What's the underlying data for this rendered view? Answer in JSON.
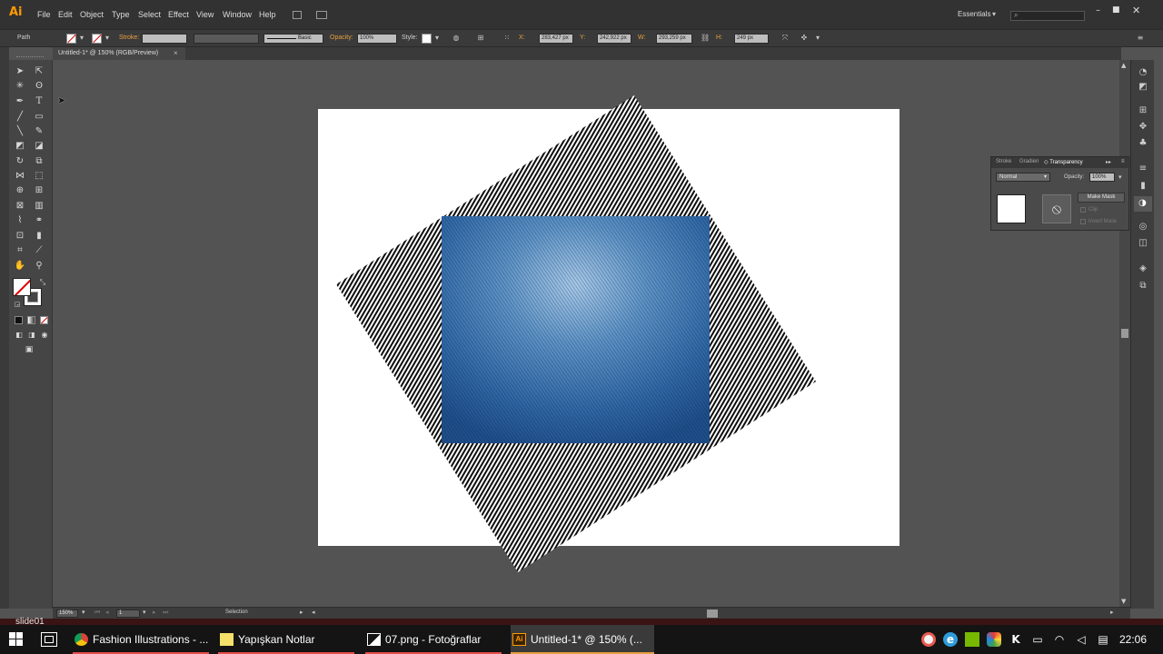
{
  "app": {
    "logo": "Ai",
    "menu": [
      "File",
      "Edit",
      "Object",
      "Type",
      "Select",
      "Effect",
      "View",
      "Window",
      "Help"
    ],
    "workspace": "Essentials",
    "search_placeholder": ""
  },
  "control_bar": {
    "selection_type": "Path",
    "stroke_label": "Stroke:",
    "brush_label": "Basic",
    "opacity_label": "Opacity:",
    "opacity_value": "100%",
    "style_label": "Style:",
    "x_label": "X:",
    "x_value": "283,427 px",
    "y_label": "Y:",
    "y_value": "242,922 px",
    "w_label": "W:",
    "w_value": "293,259 px",
    "h_label": "H:",
    "h_value": "249 px"
  },
  "document_tab": {
    "title": "Untitled-1* @ 150% (RGB/Preview)",
    "close": "×"
  },
  "transparency_panel": {
    "tabs": [
      "Stroke",
      "Gradien",
      "Transparency"
    ],
    "blend_mode": "Normal",
    "opacity_label": "Opacity:",
    "opacity_value": "100%",
    "make_mask": "Make Mask",
    "clip": "Clip",
    "invert_mask": "Invert Mask"
  },
  "status_bar": {
    "zoom": "150%",
    "artboard_number": "1",
    "tool_name": "Selection"
  },
  "canvas": {
    "slideshow_label": "slide01"
  },
  "taskbar": {
    "items": [
      {
        "label": "Fashion Illustrations - ...",
        "icon": "chrome-icon"
      },
      {
        "label": "Yapışkan Notlar",
        "icon": "sticky-notes-icon"
      },
      {
        "label": "07.png - Fotoğraflar",
        "icon": "photos-icon"
      },
      {
        "label": "Untitled-1* @ 150% (...",
        "icon": "illustrator-icon"
      }
    ],
    "clock": "22:06"
  },
  "colors": {
    "accent_orange": "#e8a040",
    "denim_blue": "#3a6ea8",
    "artboard": "#ffffff"
  }
}
